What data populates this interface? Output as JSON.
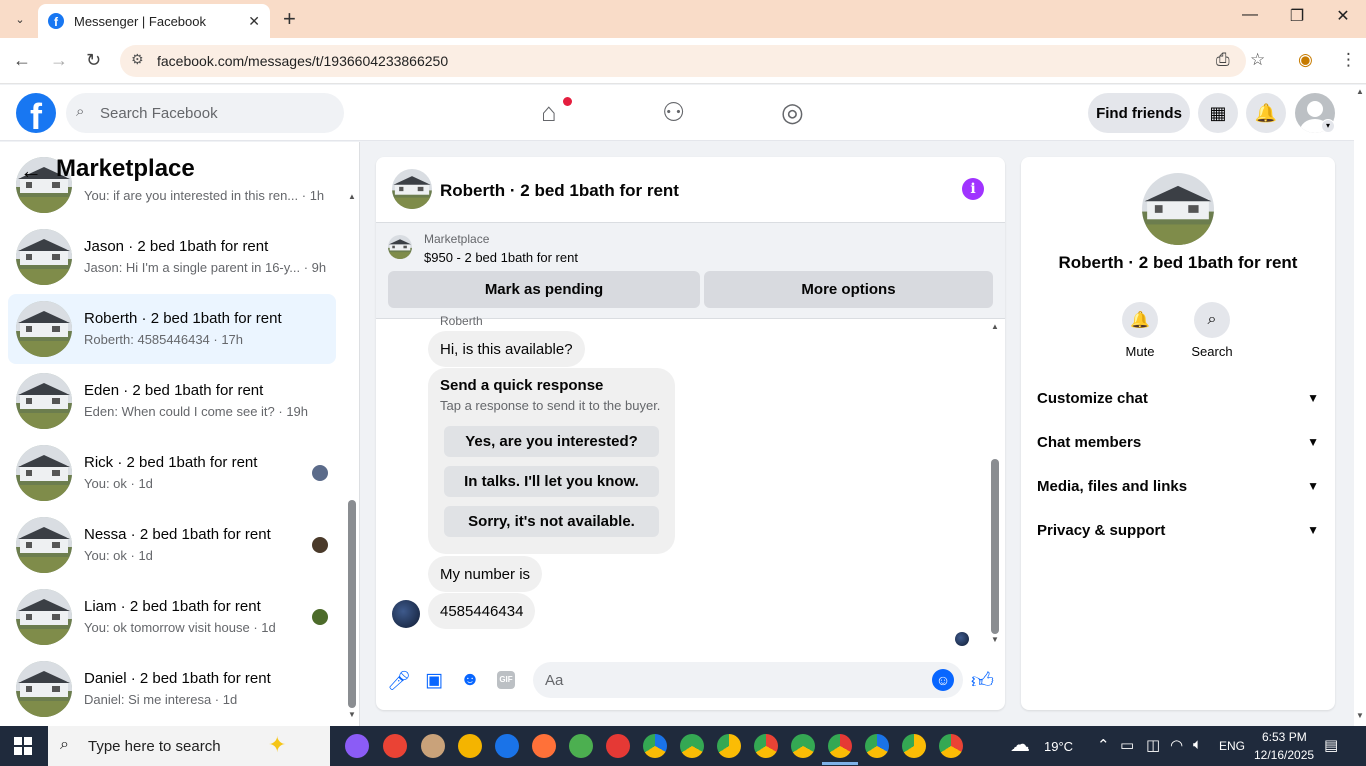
{
  "browser": {
    "tab_title": "Messenger | Facebook",
    "url": "facebook.com/messages/t/1936604233866250"
  },
  "fb": {
    "search_placeholder": "Search Facebook",
    "find_friends": "Find friends"
  },
  "sidebar": {
    "title": "Marketplace",
    "conversations": [
      {
        "name": "",
        "preview": "You: if are you interested in this ren... · 1h"
      },
      {
        "name": "Jason · 2 bed 1bath for rent",
        "preview": "Jason: Hi I'm a single parent in 16-y... · 9h"
      },
      {
        "name": "Roberth · 2 bed 1bath for rent",
        "preview": "Roberth: 4585446434 · 17h"
      },
      {
        "name": "Eden · 2 bed 1bath for rent",
        "preview": "Eden: When could I come see it? · 19h"
      },
      {
        "name": "Rick · 2 bed 1bath for rent",
        "preview": "You: ok · 1d"
      },
      {
        "name": "Nessa · 2 bed 1bath for rent",
        "preview": "You: ok · 1d"
      },
      {
        "name": "Liam · 2 bed 1bath for rent",
        "preview": "You: ok tomorrow visit house · 1d"
      },
      {
        "name": "Daniel · 2 bed 1bath for rent",
        "preview": "Daniel: Si me interesa · 1d"
      }
    ]
  },
  "chat": {
    "title": "Roberth · 2 bed 1bath for rent",
    "marketplace_label": "Marketplace",
    "listing": "$950 - 2 bed 1bath for rent",
    "mark_pending": "Mark as pending",
    "more_options": "More options",
    "sender": "Roberth",
    "msg1": "Hi, is this available?",
    "quick_title": "Send a quick response",
    "quick_sub": "Tap a response to send it to the buyer.",
    "quick_responses": [
      "Yes, are you interested?",
      "In talks. I'll let you know.",
      "Sorry, it's not available."
    ],
    "msg2": "My number is",
    "msg3": "4585446434",
    "composer_placeholder": "Aa",
    "gif_label": "GIF"
  },
  "right_panel": {
    "name": "Roberth · 2 bed 1bath for rent",
    "mute": "Mute",
    "search": "Search",
    "sections": [
      "Customize chat",
      "Chat members",
      "Media, files and links",
      "Privacy & support"
    ]
  },
  "taskbar": {
    "search_text": "Type here to search",
    "weather": "19°C",
    "lang": "ENG",
    "time": "6:53 PM",
    "date": "12/16/2025"
  },
  "colors": {
    "brand": "#1877f2",
    "messenger_blue": "#0866ff",
    "info_purple": "#a033ff",
    "active_conv": "#ebf5ff"
  }
}
